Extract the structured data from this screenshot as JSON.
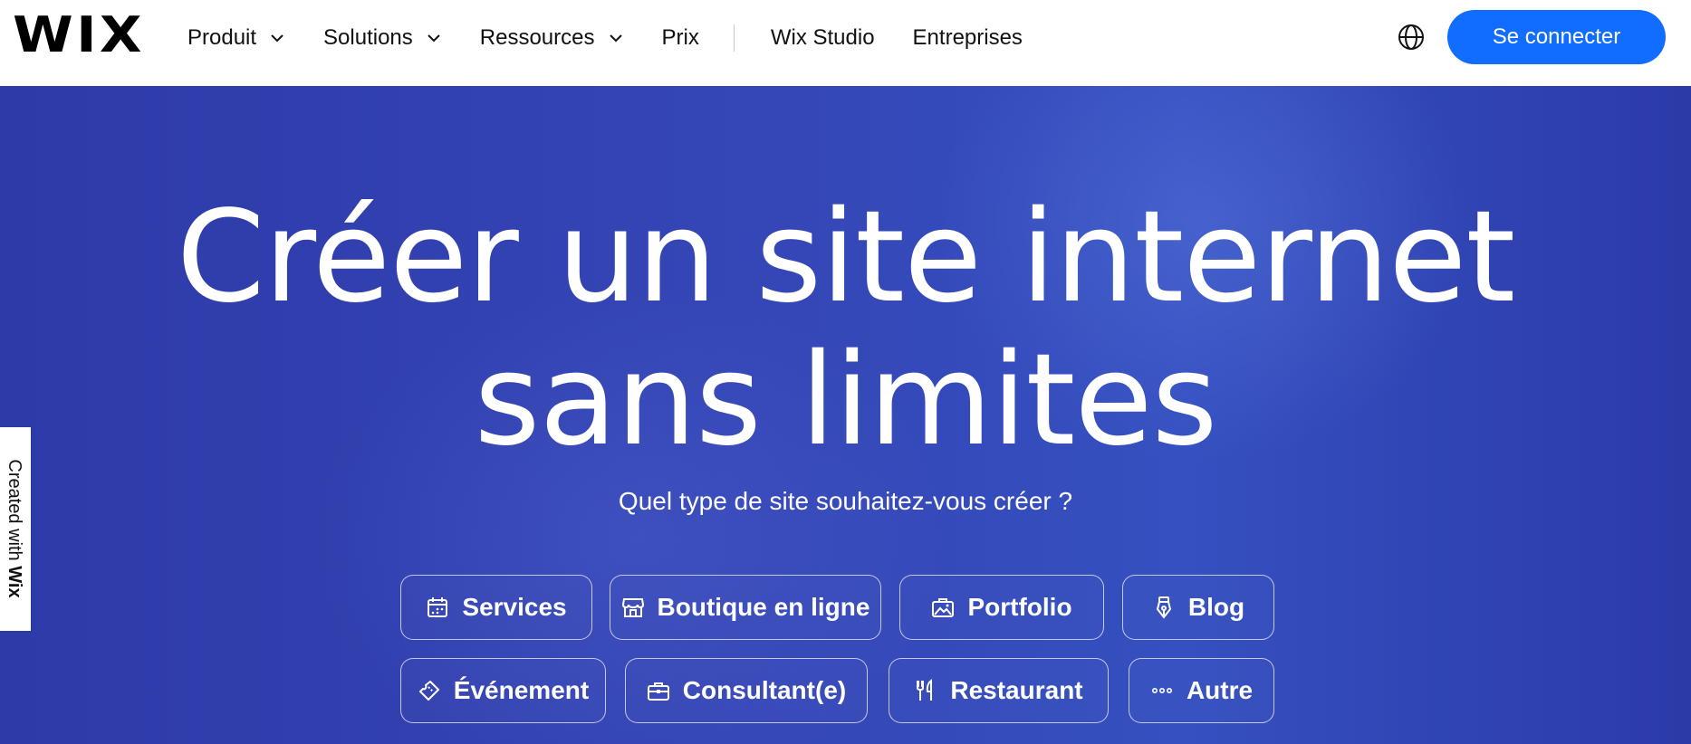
{
  "header": {
    "logo": "WIX",
    "nav": [
      {
        "label": "Produit",
        "has_dropdown": true
      },
      {
        "label": "Solutions",
        "has_dropdown": true
      },
      {
        "label": "Ressources",
        "has_dropdown": true
      },
      {
        "label": "Prix",
        "has_dropdown": false
      },
      {
        "label": "Wix Studio",
        "has_dropdown": false
      },
      {
        "label": "Entreprises",
        "has_dropdown": false
      }
    ],
    "language_icon": "globe-icon",
    "login_label": "Se connecter",
    "login_color": "#116dff"
  },
  "hero": {
    "title_line1": "Créer un site internet",
    "title_line2": "sans limites",
    "subtitle": "Quel type de site souhaitez-vous créer ?",
    "background_color": "#2f3fb0",
    "categories": [
      {
        "label": "Services",
        "icon": "calendar-icon"
      },
      {
        "label": "Boutique en ligne",
        "icon": "store-icon"
      },
      {
        "label": "Portfolio",
        "icon": "portfolio-icon"
      },
      {
        "label": "Blog",
        "icon": "pen-nib-icon"
      },
      {
        "label": "Événement",
        "icon": "ticket-icon"
      },
      {
        "label": "Consultant(e)",
        "icon": "briefcase-icon"
      },
      {
        "label": "Restaurant",
        "icon": "fork-knife-icon"
      },
      {
        "label": "Autre",
        "icon": "more-icon"
      }
    ]
  },
  "side_badge": {
    "prefix": "Created with ",
    "brand": "Wix"
  }
}
